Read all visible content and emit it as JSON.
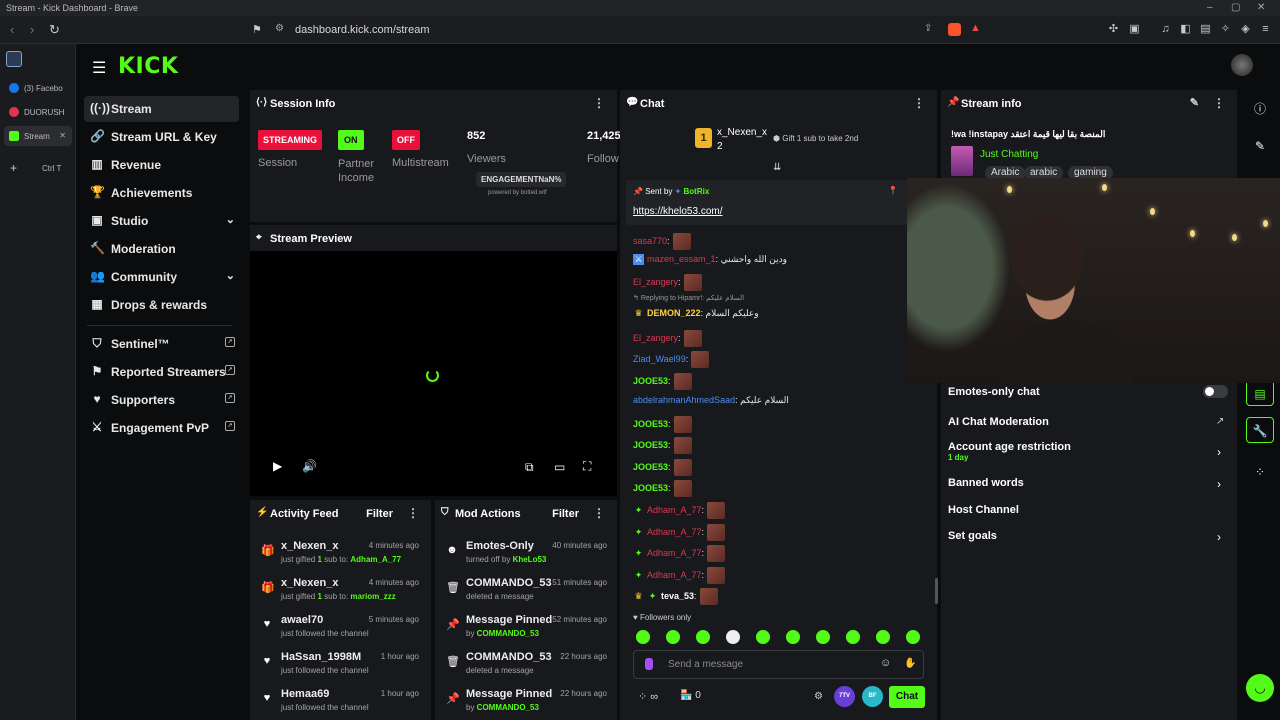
{
  "browser": {
    "window_title": "Stream - Kick Dashboard - Brave",
    "url": "dashboard.kick.com/stream",
    "tabs": [
      {
        "label": "(3) Facebo"
      },
      {
        "label": "DUORUSH"
      },
      {
        "label": "Stream"
      }
    ],
    "new_tab_shortcut": "Ctrl T"
  },
  "app": {
    "logo": "KICK",
    "nav": [
      {
        "label": "Stream",
        "icon": "broadcast-icon",
        "active": true
      },
      {
        "label": "Stream URL & Key",
        "icon": "link-icon"
      },
      {
        "label": "Revenue",
        "icon": "revenue-icon"
      },
      {
        "label": "Achievements",
        "icon": "trophy-icon"
      },
      {
        "label": "Studio",
        "icon": "studio-icon",
        "expandable": true
      },
      {
        "label": "Moderation",
        "icon": "hammer-icon"
      },
      {
        "label": "Community",
        "icon": "users-icon",
        "expandable": true
      },
      {
        "label": "Drops & rewards",
        "icon": "drops-icon"
      },
      {
        "label": "Sentinel™",
        "icon": "shield-icon",
        "external": true
      },
      {
        "label": "Reported Streamers",
        "icon": "flag-icon",
        "external": true
      },
      {
        "label": "Supporters",
        "icon": "heart-icon",
        "external": true
      },
      {
        "label": "Engagement PvP",
        "icon": "swords-icon",
        "external": true
      }
    ]
  },
  "session": {
    "title": "Session Info",
    "streaming_badge": "STREAMING",
    "streaming_label": "Session",
    "partner_badge": "ON",
    "partner_label": "Partner Income",
    "multistream_badge": "OFF",
    "multistream_label": "Multistream",
    "viewers_value": "852",
    "viewers_label": "Viewers",
    "followers_value": "21,425",
    "followers_label": "Follow",
    "engagement_label": "ENGAGEMENTNaN%",
    "powered_by": "powered by botted.wtf"
  },
  "preview": {
    "title": "Stream Preview"
  },
  "activity": {
    "title": "Activity Feed",
    "filter": "Filter",
    "items": [
      {
        "icon": "gift-icon",
        "name": "x_Nexen_x",
        "time": "4 minutes ago",
        "pre": "just gifted ",
        "count": "1",
        "mid": " sub to: ",
        "target": "Adham_A_77"
      },
      {
        "icon": "gift-icon",
        "name": "x_Nexen_x",
        "time": "4 minutes ago",
        "pre": "just gifted ",
        "count": "1",
        "mid": " sub to: ",
        "target": "mariom_zzz"
      },
      {
        "icon": "heart-icon",
        "name": "awael70",
        "time": "5 minutes ago",
        "sub": "just followed the channel"
      },
      {
        "icon": "heart-icon",
        "name": "HaSsan_1998M",
        "time": "1 hour ago",
        "sub": "just followed the channel"
      },
      {
        "icon": "heart-icon",
        "name": "Hemaa69",
        "time": "1 hour ago",
        "sub": "just followed the channel"
      }
    ]
  },
  "mod_actions": {
    "title": "Mod Actions",
    "filter": "Filter",
    "items": [
      {
        "icon": "smile-icon",
        "name": "Emotes-Only",
        "time": "40 minutes ago",
        "pre": "turned off by ",
        "by": "KheLo53"
      },
      {
        "icon": "trash-icon",
        "name": "COMMANDO_53",
        "time": "51 minutes ago",
        "sub": "deleted a message"
      },
      {
        "icon": "pin-icon",
        "name": "Message Pinned",
        "time": "52 minutes ago",
        "pre": "by ",
        "by": "COMMANDO_53"
      },
      {
        "icon": "trash-icon",
        "name": "COMMANDO_53",
        "time": "22 hours ago",
        "sub": "deleted a message"
      },
      {
        "icon": "pin-icon",
        "name": "Message Pinned",
        "time": "22 hours ago",
        "pre": "by ",
        "by": "COMMANDO_53"
      }
    ]
  },
  "chat": {
    "title": "Chat",
    "gifter_name": "x_Nexen_x",
    "gifter_count": "2",
    "gift_cta": "Gift 1 sub to take 2nd",
    "pinned_by_label": "Sent by",
    "pinned_by": "BotRix",
    "pinned_link": "https://khelo53.com/",
    "messages": [
      {
        "user": "sasa770",
        "color": "#e0364f",
        "text": ":"
      },
      {
        "user": "mazen_essam_1",
        "color": "#e0364f",
        "text": ": ودين الله واحشني"
      },
      {
        "user": "El_zangery",
        "color": "#e0364f",
        "text": ":"
      },
      {
        "user": "DEMON_222",
        "color": "#ffd23f",
        "text": ": وعليكم السلام",
        "reply": "Replying to Hipamr!: السلام عليكم"
      },
      {
        "user": "El_zangery",
        "color": "#e0364f",
        "text": ":"
      },
      {
        "user": "Ziad_Wael99",
        "color": "#4a8df0",
        "text": ":"
      },
      {
        "user": "JOOE53",
        "color": "#53fc18",
        "text": ":"
      },
      {
        "user": "abdelrahmanAhmedSaad",
        "color": "#4a8df0",
        "text": ": السلام عليكم"
      },
      {
        "user": "JOOE53",
        "color": "#53fc18",
        "text": ":"
      },
      {
        "user": "JOOE53",
        "color": "#53fc18",
        "text": ":"
      },
      {
        "user": "JOOE53",
        "color": "#53fc18",
        "text": ":"
      },
      {
        "user": "JOOE53",
        "color": "#53fc18",
        "text": ":"
      },
      {
        "user": "Adham_A_77",
        "color": "#e0364f",
        "text": ":"
      },
      {
        "user": "Adham_A_77",
        "color": "#e0364f",
        "text": ":"
      },
      {
        "user": "Adham_A_77",
        "color": "#e0364f",
        "text": ":"
      },
      {
        "user": "Adham_A_77",
        "color": "#e0364f",
        "text": ":"
      },
      {
        "user": "teva_53",
        "color": "#ffffff",
        "text": ":"
      }
    ],
    "followers_only": "Followers only",
    "input_placeholder": "Send a message",
    "points": "∞",
    "store_count": "0",
    "send_button": "Chat",
    "ext1": "7TV",
    "ext2": "BF"
  },
  "stream_info": {
    "title": "Stream info",
    "stream_title": "!wa !instapay المنصة بقا ليها قيمة اعتقد",
    "category": "Just Chatting",
    "tags": [
      "Arabic",
      "arabic",
      "gaming"
    ],
    "emotes_only": "Emotes-only chat",
    "ai_moderation": "AI Chat Moderation",
    "account_age": "Account age restriction",
    "account_age_value": "1 day",
    "banned_words": "Banned words",
    "host_channel": "Host Channel",
    "set_goals": "Set goals"
  },
  "colors": {
    "kick_green": "#53fc18",
    "streaming_red": "#e9113c",
    "panel": "#18191c"
  }
}
